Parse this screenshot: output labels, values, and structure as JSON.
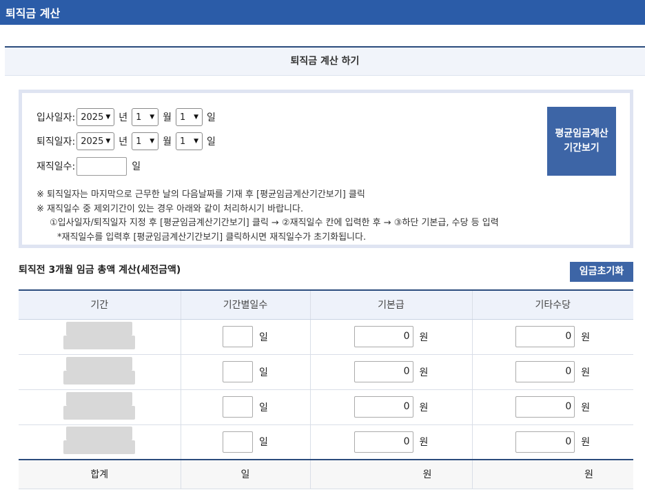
{
  "header": {
    "title": "퇴직금 계산"
  },
  "section": {
    "title": "퇴직금 계산 하기"
  },
  "dates": {
    "join": {
      "label": "입사일자:",
      "year": "2025",
      "month": "1",
      "day": "1"
    },
    "leave": {
      "label": "퇴직일자:",
      "year": "2025",
      "month": "1",
      "day": "1"
    },
    "days": {
      "label": "재직일수:",
      "value": "",
      "unit": "일"
    },
    "units": {
      "year": "년",
      "month": "월",
      "day": "일"
    }
  },
  "avg_button": {
    "line1": "평균임금계산",
    "line2": "기간보기"
  },
  "notes": {
    "n1": "※ 퇴직일자는 마지막으로 근무한 날의 다음날짜를 기재 후 [평균임금계산기간보기] 클릭",
    "n2": "※ 재직일수 중 제외기간이 있는 경우 아래와 같이 처리하시기 바랍니다.",
    "n3": "①입사일자/퇴직일자 지정 후 [평균임금계산기간보기] 클릭 → ②재직일수 칸에 입력한 후 → ③하단 기본급, 수당 등 입력",
    "n4": "*재직일수를 입력후 [평균임금계산기간보기] 클릭하시면 재직일수가 초기화됩니다."
  },
  "wage": {
    "title": "퇴직전 3개월 임금 총액 계산(세전금액)",
    "reset_label": "임금초기화",
    "headers": [
      "기간",
      "기간별일수",
      "기본급",
      "기타수당"
    ],
    "rows": [
      {
        "days": "",
        "basic": "0",
        "other": "0"
      },
      {
        "days": "",
        "basic": "0",
        "other": "0"
      },
      {
        "days": "",
        "basic": "0",
        "other": "0"
      },
      {
        "days": "",
        "basic": "0",
        "other": "0"
      }
    ],
    "day_unit": "일",
    "won_unit": "원",
    "total": {
      "label": "합계",
      "days_unit": "일",
      "basic_unit": "원",
      "other_unit": "원"
    }
  }
}
